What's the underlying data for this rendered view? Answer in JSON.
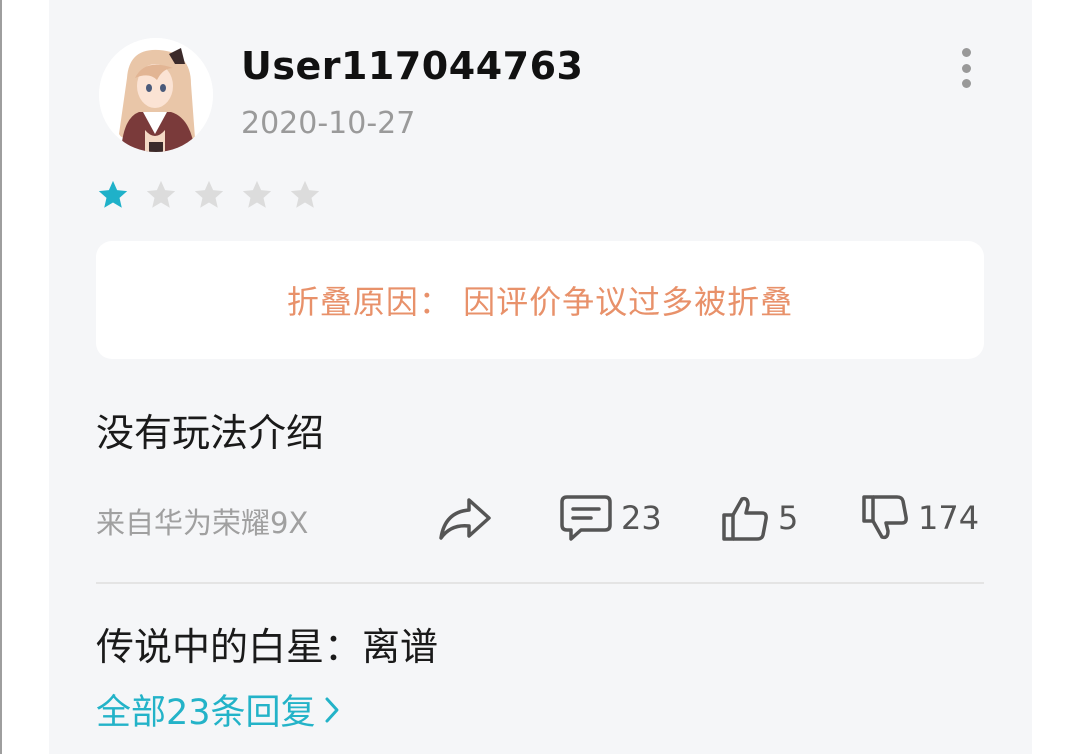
{
  "user": {
    "name": "User117044763",
    "date": "2020-10-27"
  },
  "rating": {
    "value": 1,
    "max": 5,
    "filled_color": "#1fb1c9",
    "empty_color": "#dcdcdc"
  },
  "fold_notice": {
    "text": "折叠原因： 因评价争议过多被折叠"
  },
  "review": {
    "text": "没有玩法介绍",
    "device": "来自华为荣耀9X"
  },
  "actions": {
    "comments": "23",
    "likes": "5",
    "dislikes": "174"
  },
  "reply_preview": {
    "text": "传说中的白星：离谱",
    "all_replies_label": "全部23条回复"
  },
  "colors": {
    "accent": "#23b3c8",
    "fold_text": "#e8916a"
  }
}
